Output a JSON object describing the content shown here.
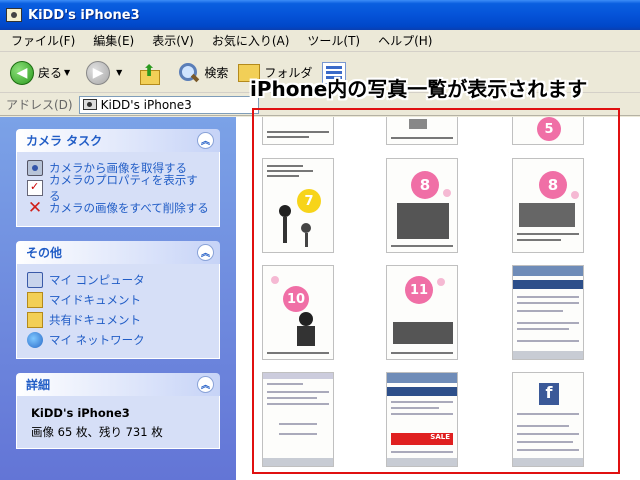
{
  "window": {
    "title": "KiDD's iPhone3"
  },
  "menu": [
    "ファイル(F)",
    "編集(E)",
    "表示(V)",
    "お気に入り(A)",
    "ツール(T)",
    "ヘルプ(H)"
  ],
  "toolbar": {
    "back_label": "戻る",
    "search_label": "検索",
    "folders_label": "フォルダ"
  },
  "address": {
    "label": "アドレス(D)",
    "value": "KiDD's iPhone3"
  },
  "sidebar": {
    "camera_tasks": {
      "title": "カメラ タスク",
      "items": [
        "カメラから画像を取得する",
        "カメラのプロパティを表示する",
        "カメラの画像をすべて削除する"
      ]
    },
    "other": {
      "title": "その他",
      "items": [
        "マイ コンピュータ",
        "マイドキュメント",
        "共有ドキュメント",
        "マイ ネットワーク"
      ]
    },
    "details": {
      "title": "詳細",
      "name": "KiDD's iPhone3",
      "info": "画像 65 枚、残り 731 枚"
    }
  },
  "annotation": {
    "text": "iPhone内の写真一覧が表示されます",
    "highlight_color": "#e01010"
  },
  "thumbnails": {
    "bubble_numbers": [
      "7",
      "8",
      "8",
      "10",
      "11"
    ],
    "corner_bubble": "5",
    "sale_text": "SALE",
    "fb_logo": "f"
  },
  "colors": {
    "titlebar": "#0553d8",
    "sidebar": "#6f8fe0",
    "task_link": "#215dc6",
    "bubble_pink": "#f06fa6",
    "bubble_yellow": "#f7d41a"
  }
}
